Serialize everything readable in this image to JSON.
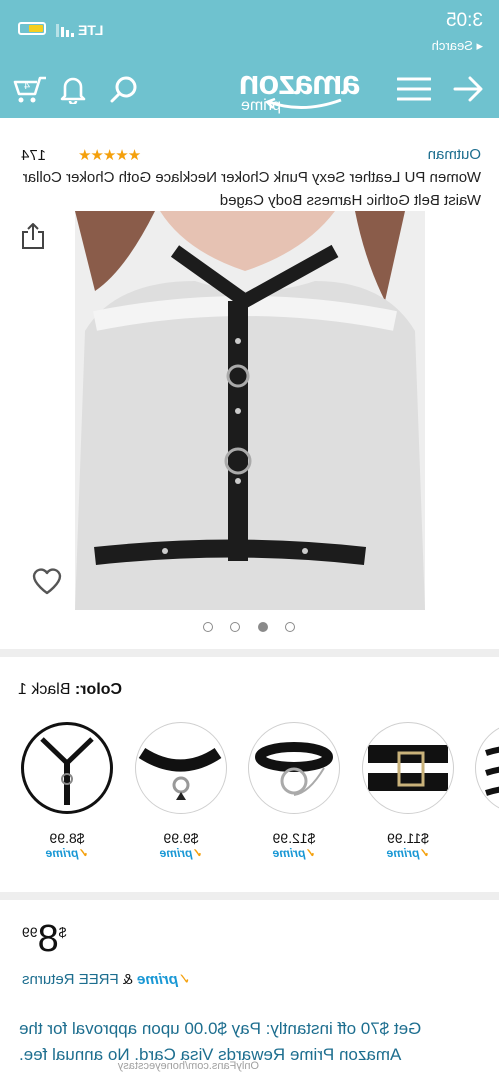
{
  "status": {
    "time": "3:05",
    "back_label": "◂ Search",
    "network": "LTE",
    "battery_color": "#f6cf1f"
  },
  "header": {
    "logo_word": "amazon",
    "logo_sub": "prime",
    "bg": "#6fc2cf"
  },
  "product": {
    "brand": "Outman",
    "rating_stars": "★★★★★",
    "rating_value": 4.5,
    "review_count": "174",
    "title": "Women PU Leather Sexy Punk Choker Necklace Goth Choker Collar Waist Belt Gothic Harness Body Caged",
    "carousel": {
      "count": 4,
      "active": 2
    }
  },
  "color": {
    "label": "Color:",
    "value": "Black 1"
  },
  "swatches": [
    {
      "price": "$8.99",
      "prime": "prime",
      "icon": "harness-icon",
      "selected": true
    },
    {
      "price": "$9.99",
      "prime": "prime",
      "icon": "studded-choker-icon",
      "selected": false
    },
    {
      "price": "$12.99",
      "prime": "prime",
      "icon": "ring-choker-icon",
      "selected": false
    },
    {
      "price": "$11.99",
      "prime": "prime",
      "icon": "buckle-collar-icon",
      "selected": false
    },
    {
      "price": "",
      "prime": "",
      "icon": "strap-belt-icon",
      "selected": false
    }
  ],
  "pricing": {
    "currency": "$",
    "dollars": "8",
    "cents": "99",
    "prime_word": "prime",
    "amp": "&",
    "free_returns": "FREE Returns"
  },
  "offer": {
    "text": "Get $70 off instantly: Pay $0.00 upon approval for the Amazon Prime Rewards Visa Card. No annual fee."
  },
  "watermark": "OnlyFans.com/honeyecstasy",
  "colors": {
    "link": "#1d6e8f",
    "star": "#f4a00c",
    "prime_blue": "#1a98d5"
  }
}
